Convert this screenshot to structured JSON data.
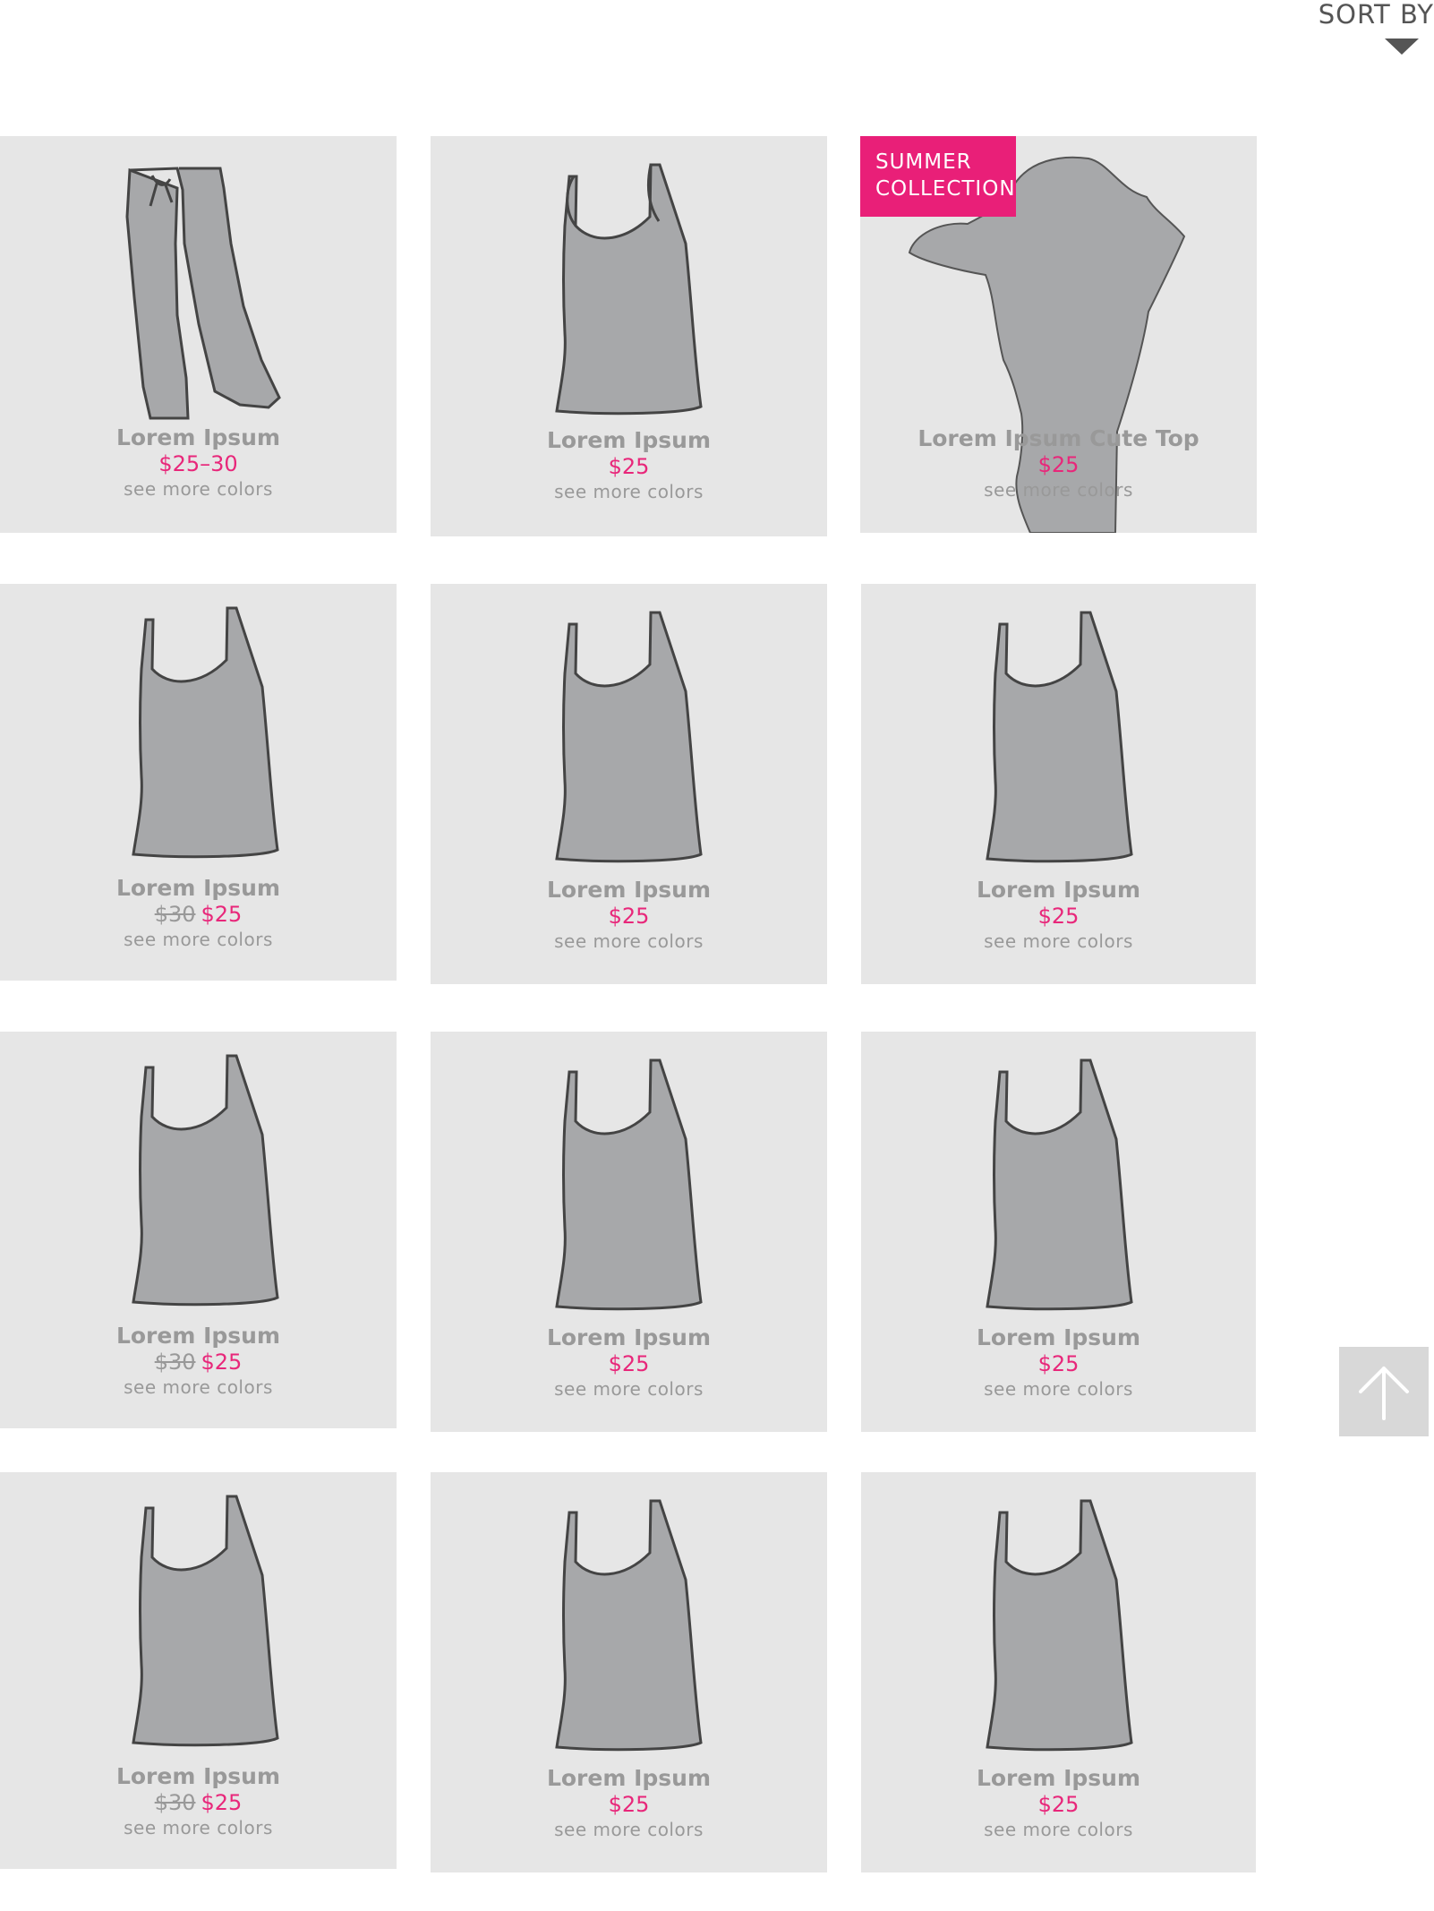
{
  "sort": {
    "label": "SORT BY"
  },
  "badge": {
    "line1": "SUMMER",
    "line2": "COLLECTION"
  },
  "products": [
    {
      "name": "Lorem Ipsum",
      "old_price": "",
      "price": "$25–30",
      "more": "see more colors",
      "image": "pants"
    },
    {
      "name": "Lorem Ipsum",
      "old_price": "",
      "price": "$25",
      "more": "see more colors",
      "image": "tank-top"
    },
    {
      "name": "Lorem Ipsum Cute Top",
      "old_price": "",
      "price": "$25",
      "more": "see more colors",
      "image": "model-silhouette"
    },
    {
      "name": "Lorem Ipsum",
      "old_price": "$30",
      "price": "$25",
      "more": "see more colors",
      "image": "tank-top"
    },
    {
      "name": "Lorem Ipsum",
      "old_price": "",
      "price": "$25",
      "more": "see more colors",
      "image": "tank-top"
    },
    {
      "name": "Lorem Ipsum",
      "old_price": "",
      "price": "$25",
      "more": "see more colors",
      "image": "tank-top"
    },
    {
      "name": "Lorem Ipsum",
      "old_price": "$30",
      "price": "$25",
      "more": "see more colors",
      "image": "tank-top"
    },
    {
      "name": "Lorem Ipsum",
      "old_price": "",
      "price": "$25",
      "more": "see more colors",
      "image": "tank-top"
    },
    {
      "name": "Lorem Ipsum",
      "old_price": "",
      "price": "$25",
      "more": "see more colors",
      "image": "tank-top"
    },
    {
      "name": "Lorem Ipsum",
      "old_price": "$30",
      "price": "$25",
      "more": "see more colors",
      "image": "tank-top"
    },
    {
      "name": "Lorem Ipsum",
      "old_price": "",
      "price": "$25",
      "more": "see more colors",
      "image": "tank-top"
    },
    {
      "name": "Lorem Ipsum",
      "old_price": "",
      "price": "$25",
      "more": "see more colors",
      "image": "tank-top"
    }
  ],
  "colors": {
    "accent": "#e91f78",
    "card_bg": "#e6e6e6",
    "muted_text": "#999999",
    "garment": "#a7a8aa"
  },
  "icons": {
    "sort": "triangle-down-icon",
    "back_to_top": "arrow-up-icon"
  }
}
